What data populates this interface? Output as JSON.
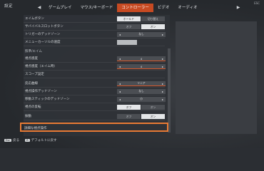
{
  "header": {
    "corner_title": "設定",
    "corner_hint": "ESC",
    "tabs": [
      {
        "label": "ゲームプレイ"
      },
      {
        "label": "マウス/キーボード"
      },
      {
        "label": "コントローラー",
        "active": true
      },
      {
        "label": "ビデオ"
      },
      {
        "label": "オーディオ"
      }
    ],
    "left_nav_icon": "left-bumper-icon",
    "right_nav_icon": "right-bumper-icon"
  },
  "settings": {
    "aim_button": {
      "label": "エイムボタン",
      "options": [
        "ホールド",
        "切り替え"
      ],
      "selected": 0
    },
    "survival_slot_button": {
      "label": "サバイバルスロットボタン",
      "options": [
        "オフ",
        "オン"
      ],
      "selected": 1
    },
    "trigger_deadzone": {
      "label": "トリガーのデッドゾーン",
      "value": "なし"
    },
    "menu_cursor_speed": {
      "label": "メニューカーソルの速度"
    },
    "section_look": {
      "label": "照準/エイム"
    },
    "look_sensitivity": {
      "label": "視点感度",
      "value": "4"
    },
    "look_sensitivity_ads": {
      "label": "視点感度（エイム時）",
      "value": "4"
    },
    "scope_settings": {
      "label": "スコープ設定"
    },
    "response_curve": {
      "label": "反応曲線",
      "value": "リニア"
    },
    "look_deadzone": {
      "label": "視点操作デッドゾーン",
      "value": "なし"
    },
    "move_stick_deadzone": {
      "label": "移動スティックのデッドゾーン",
      "value": "小"
    },
    "invert_look": {
      "label": "視点の反転",
      "options": [
        "オフ",
        "オン"
      ],
      "selected": 0
    },
    "vibration": {
      "label": "振動",
      "options": [
        "オフ",
        "オン"
      ],
      "selected": 1
    },
    "advanced_look": {
      "label": "詳細な視点操作"
    }
  },
  "values": {
    "menu_cursor_speed_fraction": 0.45
  },
  "footer": {
    "back_key": "Esc",
    "back_label": "戻る",
    "reset_key": "R",
    "reset_label": "デフォルトに戻す"
  }
}
